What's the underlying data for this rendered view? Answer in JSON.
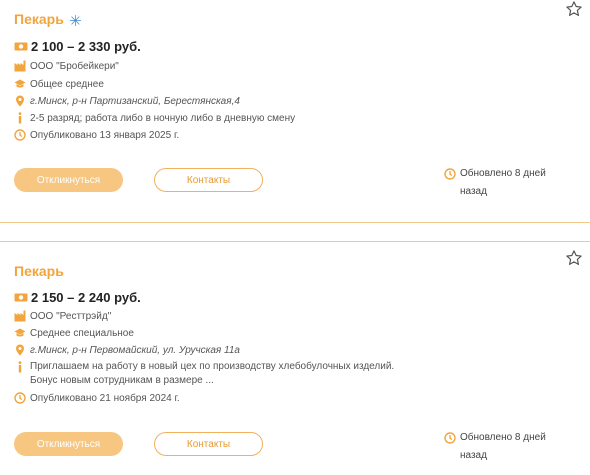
{
  "colors": {
    "accent": "#f2a53c",
    "button_fill": "#f7c681",
    "divider": "#f3c98a"
  },
  "vacancies": [
    {
      "title": "Пекарь",
      "salary": "2 100 – 2 330 руб.",
      "company": "ООО \"Бробейкери\"",
      "education": "Общее среднее",
      "address": "г.Минск, р-н Партизанский, Берестянская,4",
      "description": "2-5 разряд; работа либо в ночную либо в дневную смену",
      "published": "Опубликовано 13 января 2025 г.",
      "apply_label": "Откликнуться",
      "contacts_label": "Контакты",
      "updated": "Обновлено 8 дней назад"
    },
    {
      "title": "Пекарь",
      "salary": "2 150 – 2 240 руб.",
      "company": "ООО \"Ресттрэйд\"",
      "education": "Среднее специальное",
      "address": "г.Минск, р-н Первомайский, ул. Уручская 11а",
      "description": "Приглашаем на работу в новый цех по производству хлебобулочных изделий. Бонус новым сотрудникам в размере ...",
      "published": "Опубликовано 21 ноября 2024 г.",
      "apply_label": "Откликнуться",
      "contacts_label": "Контакты",
      "updated": "Обновлено 8 дней назад"
    }
  ]
}
